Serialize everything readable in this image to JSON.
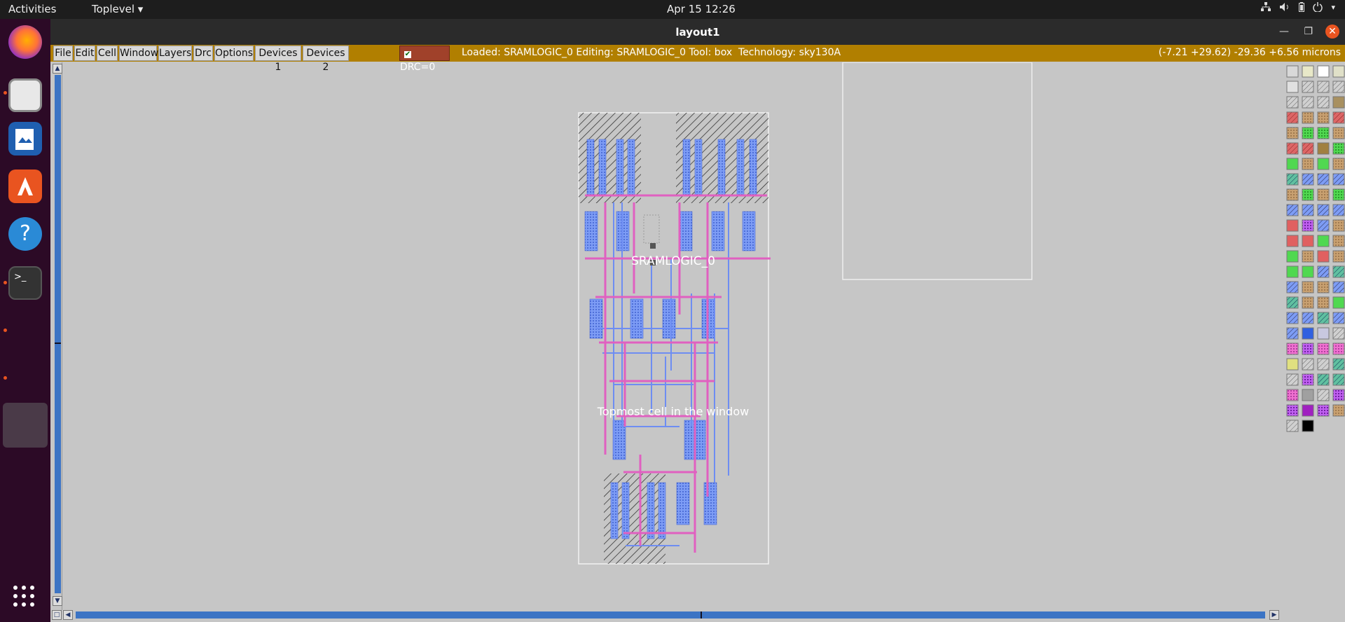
{
  "topbar": {
    "activities": "Activities",
    "app_menu": "Toplevel",
    "clock": "Apr 15  12:26"
  },
  "window": {
    "title": "layout1"
  },
  "menubar": {
    "items": [
      "File",
      "Edit",
      "Cell",
      "Window",
      "Layers",
      "Drc",
      "Options",
      "Devices 1",
      "Devices 2"
    ],
    "drc_label": "DRC=0",
    "status_text": "Loaded: SRAMLOGIC_0 Editing: SRAMLOGIC_0 Tool: box  Technology: sky130A",
    "coords_text": "(-7.21 +29.62) -29.36 +6.56 microns"
  },
  "canvas": {
    "cell_label": "SRAMLOGIC_0",
    "window_label": "Topmost cell in the window"
  },
  "dock": {
    "icons": [
      "firefox-icon",
      "files-icon",
      "writer-icon",
      "app-center-icon",
      "help-icon",
      "terminal-icon",
      "show-apps-icon"
    ]
  },
  "colors": {
    "accent": "#e95420",
    "menubar_bg": "#b17f00",
    "drc_bg": "#a0412a",
    "canvas_bg": "#c6c6c6",
    "metal_blue": "#6e8df2",
    "poly_pink": "#e060c0"
  }
}
